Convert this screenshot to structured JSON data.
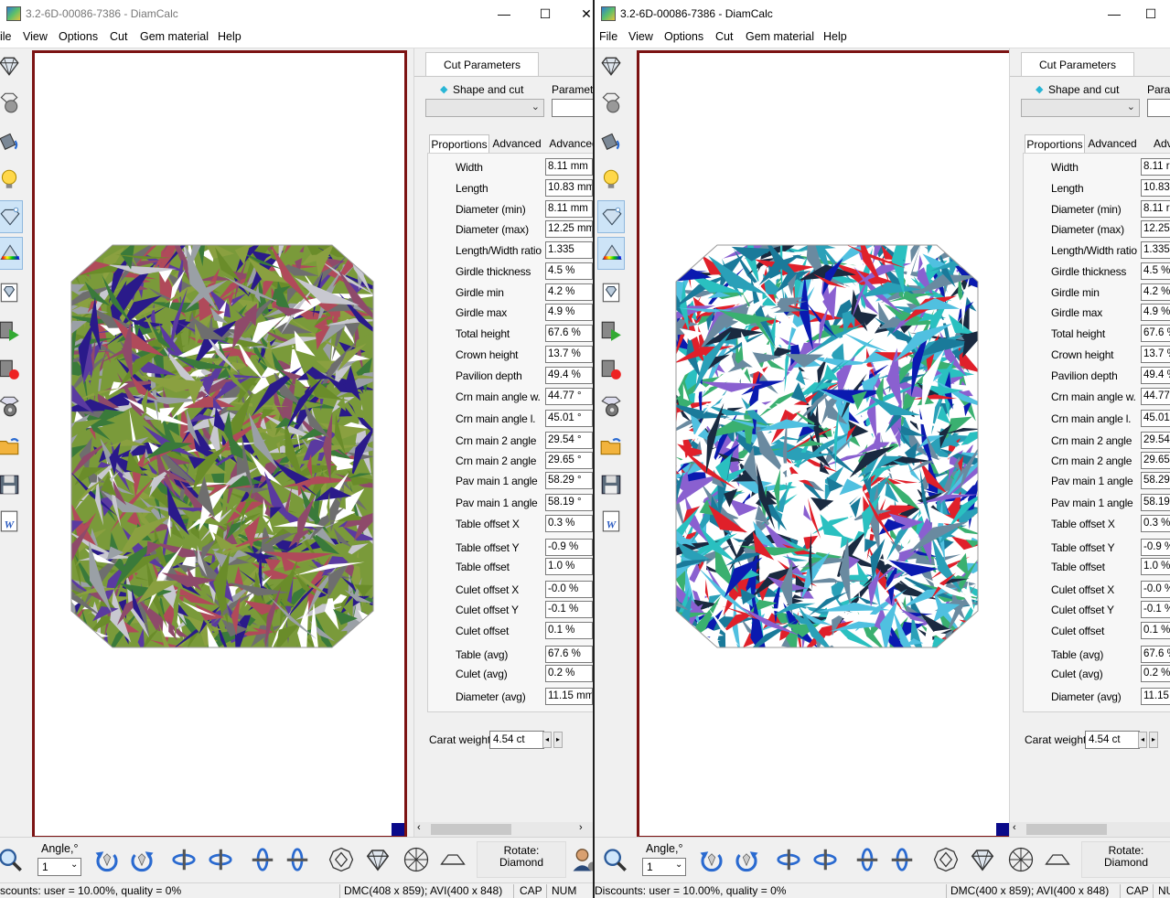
{
  "windows": [
    {
      "title": "3.2-6D-00086-7386 - DiamCalc",
      "menu": [
        "ile",
        "View",
        "Options",
        "Cut",
        "Gem material",
        "Help"
      ],
      "tab_title": "Cut Parameters",
      "shape_label": "Shape and cut",
      "params_label": "Paramete",
      "prop_tabs": [
        "Proportions",
        "Advanced",
        "Advanced"
      ],
      "params": [
        {
          "label": "Width",
          "value": "8.11 mm"
        },
        {
          "label": "Length",
          "value": "10.83 mm"
        },
        {
          "label": "Diameter (min)",
          "value": "8.11 mm"
        },
        {
          "label": "Diameter (max)",
          "value": "12.25 mm"
        },
        {
          "label": "Length/Width ratio",
          "value": "1.335"
        },
        {
          "label": "Girdle thickness",
          "value": "4.5 %"
        },
        {
          "label": "Girdle min",
          "value": "4.2 %"
        },
        {
          "label": "Girdle max",
          "value": "4.9 %"
        },
        {
          "label": "Total height",
          "value": "67.6 %"
        },
        {
          "label": "Crown height",
          "value": "13.7 %"
        },
        {
          "label": "Pavilion depth",
          "value": "49.4 %"
        },
        {
          "label": "Crn main angle w.",
          "value": "44.77 °"
        },
        {
          "label": "Crn main angle l.",
          "value": "45.01 °"
        },
        {
          "label": "Crn main 2 angle",
          "value": "29.54 °"
        },
        {
          "label": "Crn main 2 angle",
          "value": "29.65 °"
        },
        {
          "label": "Pav main 1 angle",
          "value": "58.29 °"
        },
        {
          "label": "Pav main 1 angle",
          "value": "58.19 °"
        },
        {
          "label": "Table offset X",
          "value": "0.3 %"
        },
        {
          "label": "Table offset Y",
          "value": "-0.9 %"
        },
        {
          "label": "Table offset",
          "value": "1.0 %"
        },
        {
          "label": "Culet offset X",
          "value": "-0.0 %"
        },
        {
          "label": "Culet offset Y",
          "value": "-0.1 %"
        },
        {
          "label": "Culet offset",
          "value": "0.1 %"
        },
        {
          "label": "Table (avg)",
          "value": "67.6 %"
        },
        {
          "label": "Culet (avg)",
          "value": "0.2 %"
        },
        {
          "label": "Diameter (avg)",
          "value": "11.15 mm"
        }
      ],
      "carat_label": "Carat weight",
      "carat_value": "4.54 ct",
      "angle_label": "Angle,°",
      "angle_value": "1",
      "rotate_label": "Rotate:",
      "rotate_value": "Diamond",
      "status": {
        "discounts": "scounts: user = 10.00%, quality = 0%",
        "dims": "DMC(408 x 859); AVI(400 x 848)",
        "cap": "CAP",
        "num": "NUM"
      }
    },
    {
      "title": "3.2-6D-00086-7386 - DiamCalc",
      "menu": [
        "File",
        "View",
        "Options",
        "Cut",
        "Gem material",
        "Help"
      ],
      "tab_title": "Cut Parameters",
      "shape_label": "Shape and cut",
      "params_label": "Para",
      "prop_tabs": [
        "Proportions",
        "Advanced",
        "Advan"
      ],
      "params": [
        {
          "label": "Width",
          "value": "8.11 r"
        },
        {
          "label": "Length",
          "value": "10.83"
        },
        {
          "label": "Diameter (min)",
          "value": "8.11 r"
        },
        {
          "label": "Diameter (max)",
          "value": "12.25"
        },
        {
          "label": "Length/Width ratio",
          "value": "1.335"
        },
        {
          "label": "Girdle thickness",
          "value": "4.5 %"
        },
        {
          "label": "Girdle min",
          "value": "4.2 %"
        },
        {
          "label": "Girdle max",
          "value": "4.9 %"
        },
        {
          "label": "Total height",
          "value": "67.6 %"
        },
        {
          "label": "Crown height",
          "value": "13.7 %"
        },
        {
          "label": "Pavilion depth",
          "value": "49.4 %"
        },
        {
          "label": "Crn main angle w.",
          "value": "44.77"
        },
        {
          "label": "Crn main angle l.",
          "value": "45.01"
        },
        {
          "label": "Crn main 2 angle",
          "value": "29.54"
        },
        {
          "label": "Crn main 2 angle",
          "value": "29.65"
        },
        {
          "label": "Pav main 1 angle",
          "value": "58.29"
        },
        {
          "label": "Pav main 1 angle",
          "value": "58.19"
        },
        {
          "label": "Table offset X",
          "value": "0.3 %"
        },
        {
          "label": "Table offset Y",
          "value": "-0.9 %"
        },
        {
          "label": "Table offset",
          "value": "1.0 %"
        },
        {
          "label": "Culet offset X",
          "value": "-0.0 %"
        },
        {
          "label": "Culet offset Y",
          "value": "-0.1 %"
        },
        {
          "label": "Culet offset",
          "value": "0.1 %"
        },
        {
          "label": "Table (avg)",
          "value": "67.6 %"
        },
        {
          "label": "Culet (avg)",
          "value": "0.2 %"
        },
        {
          "label": "Diameter (avg)",
          "value": "11.15"
        }
      ],
      "carat_label": "Carat weight",
      "carat_value": "4.54 ct",
      "angle_label": "Angle,°",
      "angle_value": "1",
      "rotate_label": "Rotate:",
      "rotate_value": "Diamond",
      "status": {
        "discounts": "Discounts: user = 10.00%, quality = 0%",
        "dims": "DMC(400 x 859); AVI(400 x 848)",
        "cap": "CAP",
        "num": "NU"
      }
    }
  ],
  "colors": {
    "viewport_border": "#7c1313",
    "viewport_corner": "#0a0a8a",
    "left_gem_palette": [
      "#7a9a3a",
      "#6a8c2a",
      "#8e4a6a",
      "#5a3aa0",
      "#2a1a8a",
      "#9aa0a6",
      "#6e6e6e",
      "#c8c8d0",
      "#3a7a3a",
      "#b04a5a",
      "#ffffff",
      "#8aa040"
    ],
    "right_gem_palette": [
      "#2aa0b8",
      "#1a7a9a",
      "#ffffff",
      "#0a1ab0",
      "#2ac0c0",
      "#3ab070",
      "#e0202a",
      "#6a8aa0",
      "#50c0e0",
      "#8a60d0",
      "#1a2a40",
      "#ffffff"
    ]
  },
  "icons": {
    "left_toolbar": [
      "diamond-view-icon",
      "gem-sphere-icon",
      "paint-bucket-icon",
      "light-bulb-icon",
      "diamond-sparkle-icon",
      "spectrum-icon",
      "diamond-card-icon",
      "video-play-icon",
      "video-record-icon",
      "film-reel-icon",
      "open-folder-icon",
      "save-disk-icon",
      "word-export-icon"
    ],
    "bottom_toolbar": [
      "zoom-icon",
      "rotate-ccw-icon",
      "rotate-cw-icon",
      "flip-h-left-icon",
      "flip-h-right-icon",
      "flip-v-up-icon",
      "flip-v-down-icon",
      "top-view-icon",
      "side-view-icon",
      "bottom-view-icon",
      "crown-view-icon",
      "user-icon"
    ]
  }
}
